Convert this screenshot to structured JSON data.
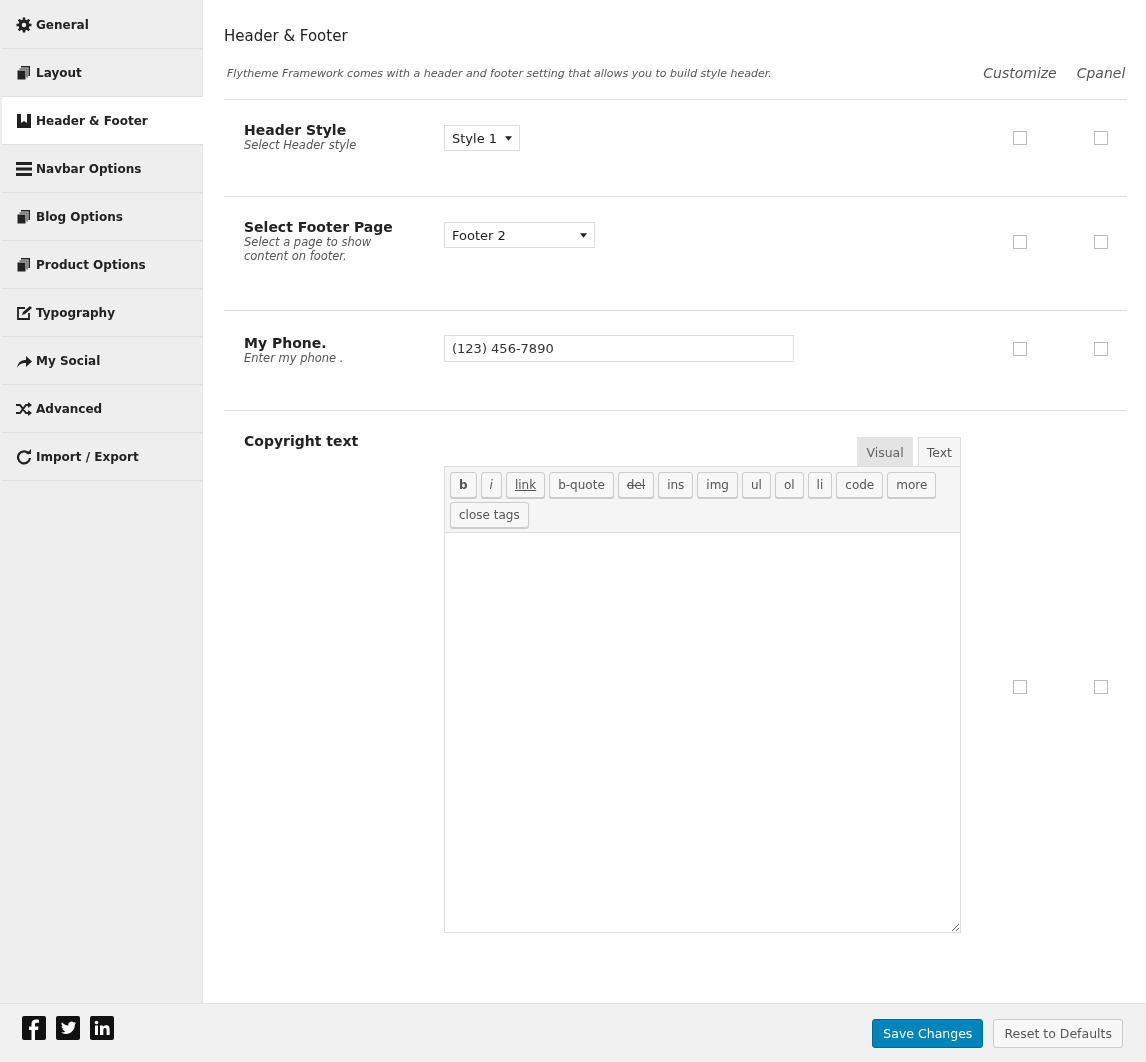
{
  "sidebar": {
    "items": [
      {
        "label": "General",
        "selected": false
      },
      {
        "label": "Layout",
        "selected": false
      },
      {
        "label": "Header & Footer",
        "selected": true
      },
      {
        "label": "Navbar Options",
        "selected": false
      },
      {
        "label": "Blog Options",
        "selected": false
      },
      {
        "label": "Product Options",
        "selected": false
      },
      {
        "label": "Typography",
        "selected": false
      },
      {
        "label": "My Social",
        "selected": false
      },
      {
        "label": "Advanced",
        "selected": false
      },
      {
        "label": "Import / Export",
        "selected": false
      }
    ]
  },
  "section": {
    "title": "Header & Footer",
    "description": "Flytheme Framework comes with a header and footer setting that allows you to build style header.",
    "columns": [
      "Customize",
      "Cpanel"
    ]
  },
  "fields": [
    {
      "kind": "select",
      "label": "Header Style",
      "description": "Select Header style",
      "value": "Style 1",
      "customize": false,
      "cpanel": false
    },
    {
      "kind": "select",
      "label": "Select Footer Page",
      "description": "Select a page to show content on footer.",
      "value": "Footer 2",
      "customize": false,
      "cpanel": false
    },
    {
      "kind": "text",
      "label": "My Phone.",
      "description": "Enter my phone .",
      "value": "(123) 456-7890",
      "customize": false,
      "cpanel": false
    },
    {
      "kind": "editor",
      "label": "Copyright text",
      "customize": false,
      "cpanel": false,
      "tabs": [
        {
          "label": "Visual",
          "selected": false
        },
        {
          "label": "Text",
          "selected": true
        }
      ],
      "quicktags": [
        "b",
        "i",
        "link",
        "b-quote",
        "del",
        "ins",
        "img",
        "ul",
        "ol",
        "li",
        "code",
        "more",
        "close tags"
      ]
    }
  ],
  "footer": {
    "buttons": [
      {
        "label": "Save Changes",
        "kind": "primary"
      },
      {
        "label": "Reset to Defaults",
        "kind": "secondary"
      }
    ]
  }
}
